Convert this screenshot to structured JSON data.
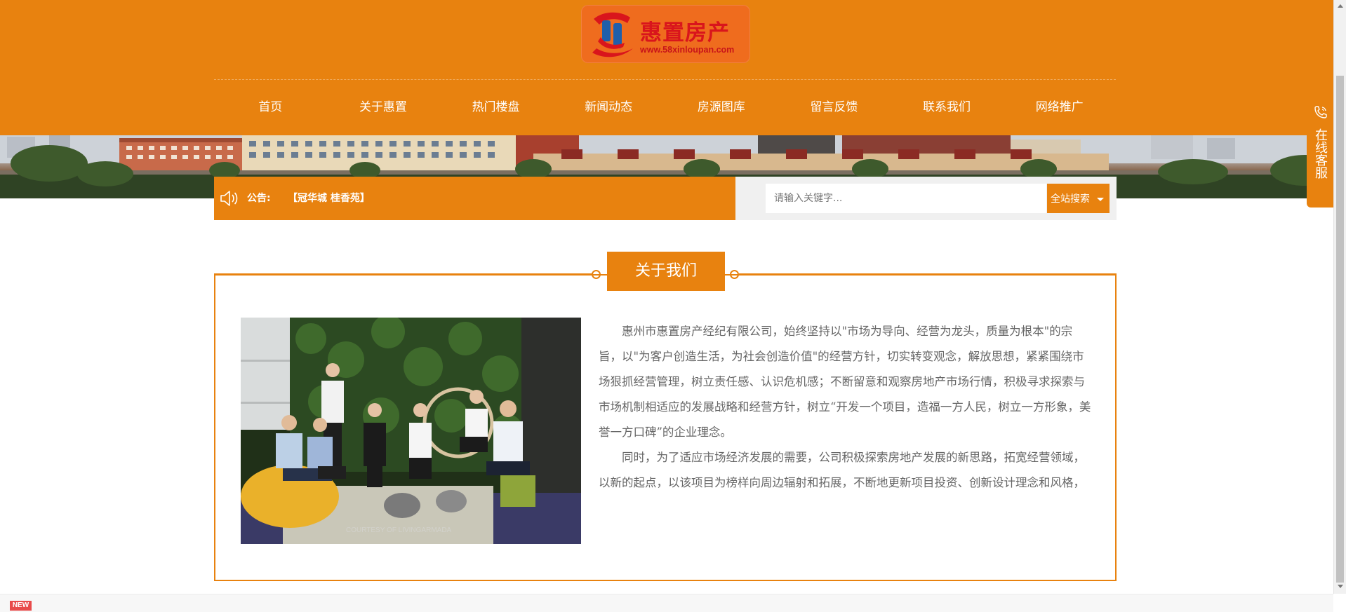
{
  "logo": {
    "name": "惠置房产",
    "url": "www.58xinloupan.com"
  },
  "nav": {
    "items": [
      "首页",
      "关于惠置",
      "热门楼盘",
      "新闻动态",
      "房源图库",
      "留言反馈",
      "联系我们",
      "网络推广"
    ]
  },
  "notice": {
    "label": "公告:",
    "link": "【冠华城 桂香苑】"
  },
  "search": {
    "placeholder": "请输入关键字...",
    "button_label": "全站搜索"
  },
  "about": {
    "title": "关于我们",
    "paragraph1": "惠州市惠置房产经纪有限公司，始终坚持以\"市场为导向、经营为龙头，质量为根本\"的宗旨，以\"为客户创造生活，为社会创造价值\"的经营方针，切实转变观念，解放思想，紧紧围绕市场狠抓经营管理，树立责任感、认识危机感；不断留意和观察房地产市场行情，积极寻求探索与市场机制相适应的发展战略和经营方针，树立“开发一个项目，造福一方人民，树立一方形象，美誉一方口碑”的企业理念。",
    "paragraph2": "同时，为了适应市场经济发展的需要，公司积极探索房地产发展的新思路，拓宽经营领域，以新的起点，以该项目为榜样向周边辐射和拓展，不断地更新项目投资、创新设计理念和风格，为客户提供更好的技术服务，有志于成为惠州乃至广东省的房地产经济行业排头企业！",
    "photo_watermark": "COURTESY OF LIVINGARMADA"
  },
  "side_service": {
    "label": "在线客服"
  },
  "badge": {
    "label": "NEW"
  },
  "colors": {
    "accent": "#e8820f",
    "logo_bg": "#ef6c1e",
    "logo_text": "#d9151c"
  },
  "icons": {
    "notice": "speaker-icon",
    "service": "phone-icon",
    "search_caret": "caret-down-icon"
  }
}
